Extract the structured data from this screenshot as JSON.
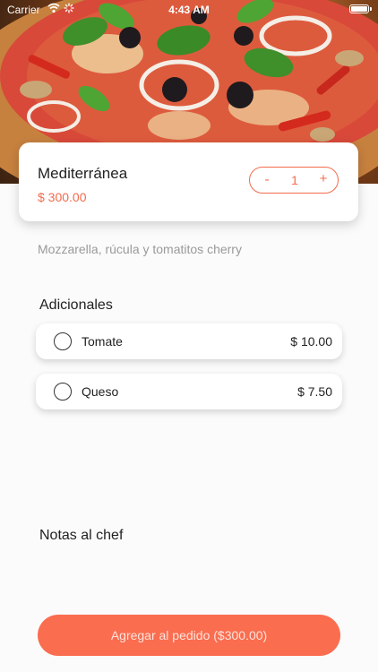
{
  "status_bar": {
    "carrier": "Carrier",
    "time": "4:43 AM"
  },
  "product": {
    "name": "Mediterránea",
    "price": "$ 300.00",
    "description": "Mozzarella, rúcula y tomatitos cherry",
    "quantity": "1",
    "minus_label": "-",
    "plus_label": "+"
  },
  "addons": {
    "title": "Adicionales",
    "items": [
      {
        "label": "Tomate",
        "price": "$ 10.00",
        "selected": false
      },
      {
        "label": "Queso",
        "price": "$ 7.50",
        "selected": false
      }
    ]
  },
  "notes": {
    "title": "Notas al chef"
  },
  "cta": {
    "label": "Agregar al pedido ($300.00)"
  },
  "colors": {
    "accent": "#f26b4c",
    "button": "#fa6d4f",
    "background": "#fbfbfb"
  },
  "icons": {
    "wifi": "wifi-icon",
    "activity": "activity-spinner-icon",
    "battery": "battery-icon",
    "hero": "pizza-image"
  }
}
